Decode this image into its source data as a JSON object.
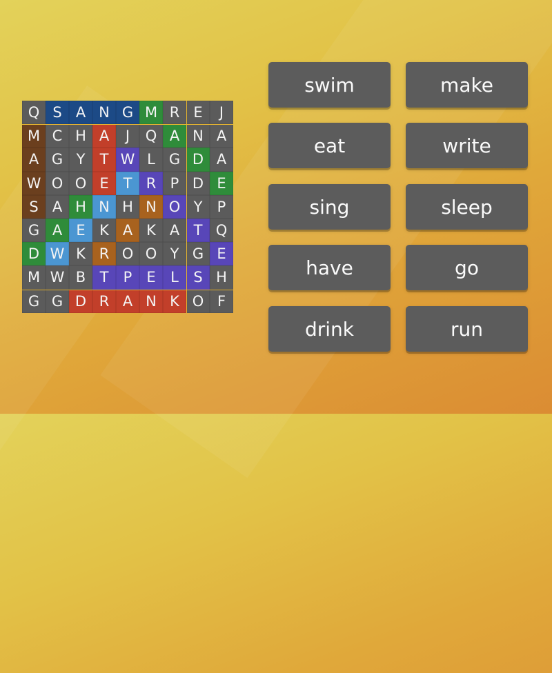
{
  "activity": {
    "type": "wordsearch",
    "colors": {
      "background_top": "#e3d25a",
      "background_bottom": "#db8c33",
      "cell_default": "#5b5b5b",
      "navy": "#1c4a86",
      "green": "#2f8c3a",
      "red": "#c23f2a",
      "brown": "#6b3f1e",
      "purple": "#5846b8",
      "lightblue": "#4b96d2",
      "orange": "#a8621e",
      "button": "#5c5c5c",
      "text": "#fafafa"
    }
  },
  "grid": {
    "rows": [
      {
        "letters": [
          "Q",
          "S",
          "A",
          "N",
          "G",
          "M",
          "R",
          "E",
          "J"
        ],
        "colors": [
          "gray",
          "navy",
          "navy",
          "navy",
          "navy",
          "green",
          "gray",
          "gray",
          "gray"
        ]
      },
      {
        "letters": [
          "M",
          "C",
          "H",
          "A",
          "J",
          "Q",
          "A",
          "N",
          "A"
        ],
        "colors": [
          "brown",
          "gray",
          "gray",
          "red",
          "gray",
          "gray",
          "green",
          "gray",
          "gray"
        ]
      },
      {
        "letters": [
          "A",
          "G",
          "Y",
          "T",
          "W",
          "L",
          "G",
          "D",
          "A"
        ],
        "colors": [
          "brown",
          "gray",
          "gray",
          "red",
          "purple",
          "gray",
          "gray",
          "green",
          "gray"
        ]
      },
      {
        "letters": [
          "W",
          "O",
          "O",
          "E",
          "T",
          "R",
          "P",
          "D",
          "E"
        ],
        "colors": [
          "brown",
          "gray",
          "gray",
          "red",
          "lightblue",
          "purple",
          "gray",
          "gray",
          "green"
        ]
      },
      {
        "letters": [
          "S",
          "A",
          "H",
          "N",
          "H",
          "N",
          "O",
          "Y",
          "P"
        ],
        "colors": [
          "brown",
          "gray",
          "green",
          "lightblue",
          "gray",
          "orange",
          "purple",
          "gray",
          "gray"
        ]
      },
      {
        "letters": [
          "G",
          "A",
          "E",
          "K",
          "A",
          "K",
          "A",
          "T",
          "Q"
        ],
        "colors": [
          "gray",
          "green",
          "lightblue",
          "gray",
          "orange",
          "gray",
          "gray",
          "purple",
          "gray"
        ]
      },
      {
        "letters": [
          "D",
          "W",
          "K",
          "R",
          "O",
          "O",
          "Y",
          "G",
          "E"
        ],
        "colors": [
          "green",
          "lightblue",
          "gray",
          "orange",
          "gray",
          "gray",
          "gray",
          "gray",
          "purple"
        ]
      },
      {
        "letters": [
          "M",
          "W",
          "B",
          "T",
          "P",
          "E",
          "L",
          "S",
          "H"
        ],
        "colors": [
          "gray",
          "gray",
          "gray",
          "purple",
          "purple",
          "purple",
          "purple",
          "purple",
          "gray"
        ]
      },
      {
        "letters": [
          "G",
          "G",
          "D",
          "R",
          "A",
          "N",
          "K",
          "O",
          "F"
        ],
        "colors": [
          "gray",
          "gray",
          "red",
          "red",
          "red",
          "red",
          "red",
          "gray",
          "gray"
        ]
      }
    ]
  },
  "words": [
    {
      "label": "swim"
    },
    {
      "label": "make"
    },
    {
      "label": "eat"
    },
    {
      "label": "write"
    },
    {
      "label": "sing"
    },
    {
      "label": "sleep"
    },
    {
      "label": "have"
    },
    {
      "label": "go"
    },
    {
      "label": "drink"
    },
    {
      "label": "run"
    }
  ]
}
